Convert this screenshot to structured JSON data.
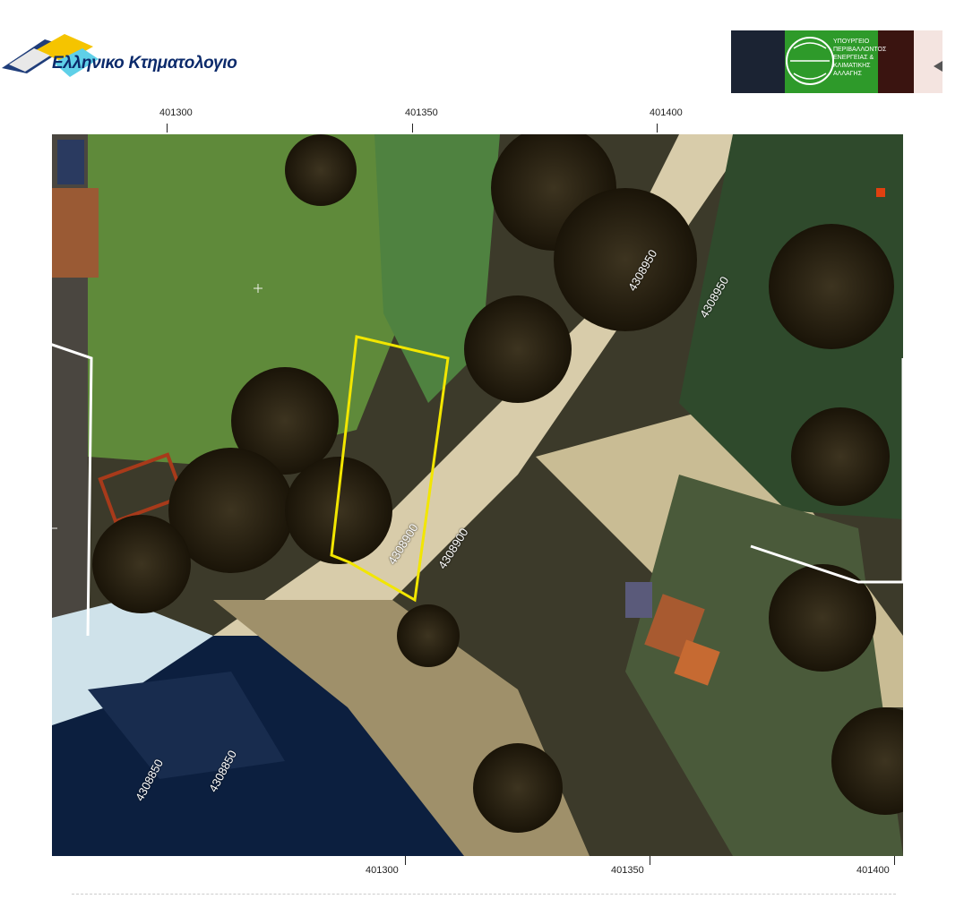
{
  "header": {
    "logo_title": "Ελληνικο Κτηματολογιο",
    "logo_subtitle": "",
    "ministry_lines": [
      "ΥΠΟΥΡΓΕΙΟ",
      "ΠΕΡΙΒΑΛΛΟΝΤΟΣ",
      "ΕΝΕΡΓΕΙΑΣ &",
      "ΚΛΙΜΑΤΙΚΗΣ",
      "ΑΛΛΑΓΗΣ"
    ]
  },
  "top_axis": {
    "labels": [
      "401300",
      "401350",
      "401400"
    ]
  },
  "bottom_axis": {
    "labels": [
      "401300",
      "401350",
      "401400"
    ]
  },
  "map_labels": {
    "northing_upper_1": "4308950",
    "northing_upper_2": "4308950",
    "northing_mid": "4308900",
    "northing_parcel": "4308900",
    "northing_lower_1": "4308850",
    "northing_lower_2": "4308850"
  },
  "colors": {
    "parcel_outline": "#f2e600",
    "grid_lines": "#ffffff",
    "road": "#d8ccaa",
    "sea": "#0c1f3f"
  }
}
